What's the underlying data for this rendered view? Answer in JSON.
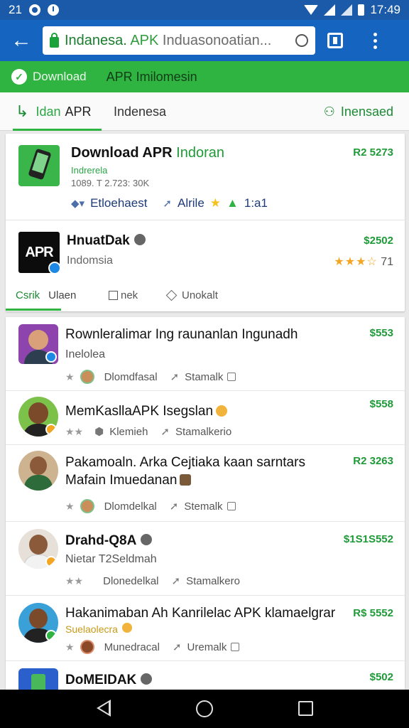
{
  "status_bar": {
    "time_left": "21",
    "time_right": "17:49"
  },
  "toolbar": {
    "url_part1": "Indanesa.",
    "url_part2": "APK",
    "url_part3": "Induasonoatian..."
  },
  "banner": {
    "label1": "Download",
    "label2": "APR Imilomesin"
  },
  "tabs": [
    {
      "icon": "↳",
      "label1": "Idan",
      "label2": "APR"
    },
    {
      "label": "Indenesa"
    },
    {
      "icon": "⚇",
      "label": "Inensaed"
    }
  ],
  "featured": {
    "title": "Download APR",
    "title_green": "Indoran",
    "sub1": "Indrerela",
    "sub2": "1089. T 2.723: 30K",
    "meta1": "Etloehaest",
    "meta2": "Alrile",
    "meta3": "1:a1",
    "price": "R2 5273"
  },
  "app2": {
    "icon_text": "APR",
    "title": "HnuatDak",
    "subtitle": "Indomsia",
    "price": "$2502",
    "stars": "★★★☆",
    "rating_count": "71",
    "subtabs": [
      "Csrik",
      "Ulaen",
      "nek",
      "Unokalt"
    ]
  },
  "items": [
    {
      "title": "Rownleralimar Ing raunanlan Ingunadh",
      "sub": "Inelolea",
      "price": "$553",
      "meta1": "Dlomdfasal",
      "meta2": "Stamalk",
      "icon": "av-purple"
    },
    {
      "title": "MemKasllaAPK Isegslan",
      "price": "$558",
      "meta1": "Klemieh",
      "meta2": "Stamalkerio",
      "icon": "av-green"
    },
    {
      "title": "Pakamoaln. Arka Cejtiaka kaan sarntars Mafain Imuedanan",
      "price": "R2 3263",
      "meta1": "Dlomdelkal",
      "meta2": "Stemalk",
      "icon": "av-dark"
    },
    {
      "title": "Drahd-Q8A",
      "sub": "Nietar T2Seldmah",
      "price": "$1S1S552",
      "meta1": "Dlonedelkal",
      "meta2": "Stamalkero",
      "icon": "av-man"
    },
    {
      "title": "Hakanimaban Ah Kanrilelac APK klamaelgrar",
      "sub": "Suelaolecra",
      "price": "R$ 5552",
      "meta1": "Munedracal",
      "meta2": "Uremalk",
      "icon": "av-man2"
    },
    {
      "title": "DoMEIDAK",
      "price": "$502",
      "icon": "av-blue"
    }
  ],
  "colors": {
    "toolbar": "#1565c0",
    "statusbar": "#1a5aa8",
    "accent_green": "#2fb341",
    "price_green": "#1f9a38"
  }
}
